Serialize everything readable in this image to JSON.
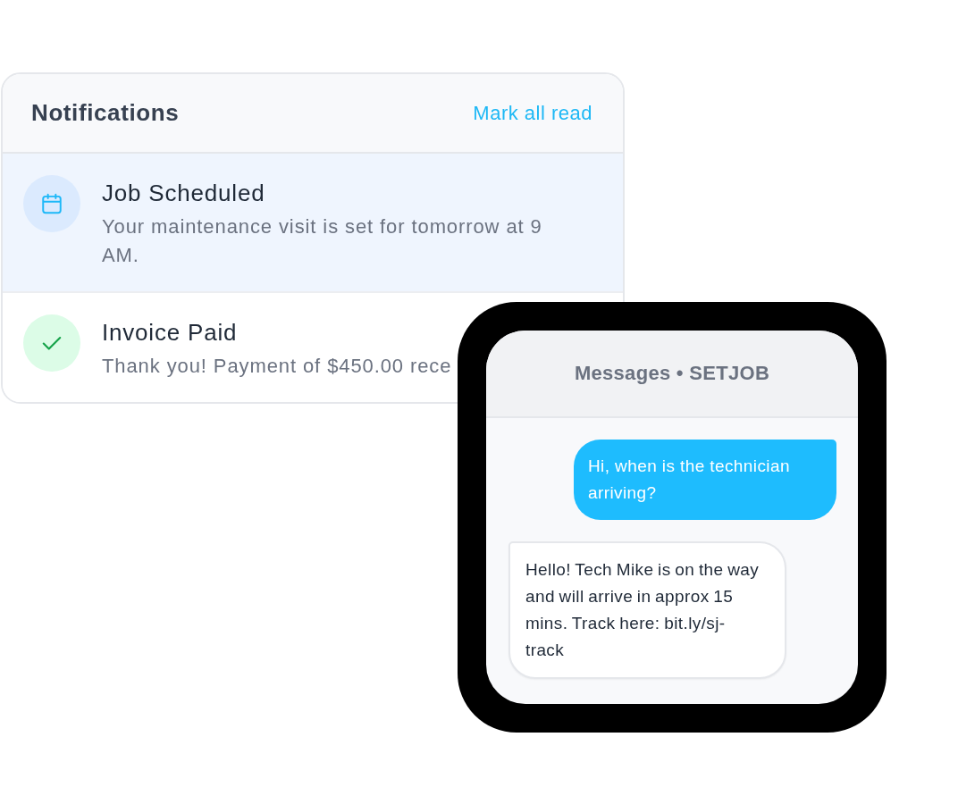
{
  "notifications": {
    "title": "Notifications",
    "action": "Mark all read",
    "items": [
      {
        "kind": "calendar",
        "title": "Job Scheduled",
        "text": "Your maintenance visit is set for tomorrow at 9 AM.",
        "unread": true
      },
      {
        "kind": "check",
        "title": "Invoice Paid",
        "text": "Thank you! Payment of $450.00 rece",
        "unread": false
      }
    ]
  },
  "chat": {
    "title": "Messages • SETJOB",
    "messages": [
      {
        "kind": "outgoing",
        "text": "Hi, when is the technician arriving?"
      },
      {
        "kind": "incoming",
        "text": "Hello! Tech Mike is on the way and will arrive in approx 15 mins. Track here: bit.ly/sj-track"
      }
    ]
  }
}
